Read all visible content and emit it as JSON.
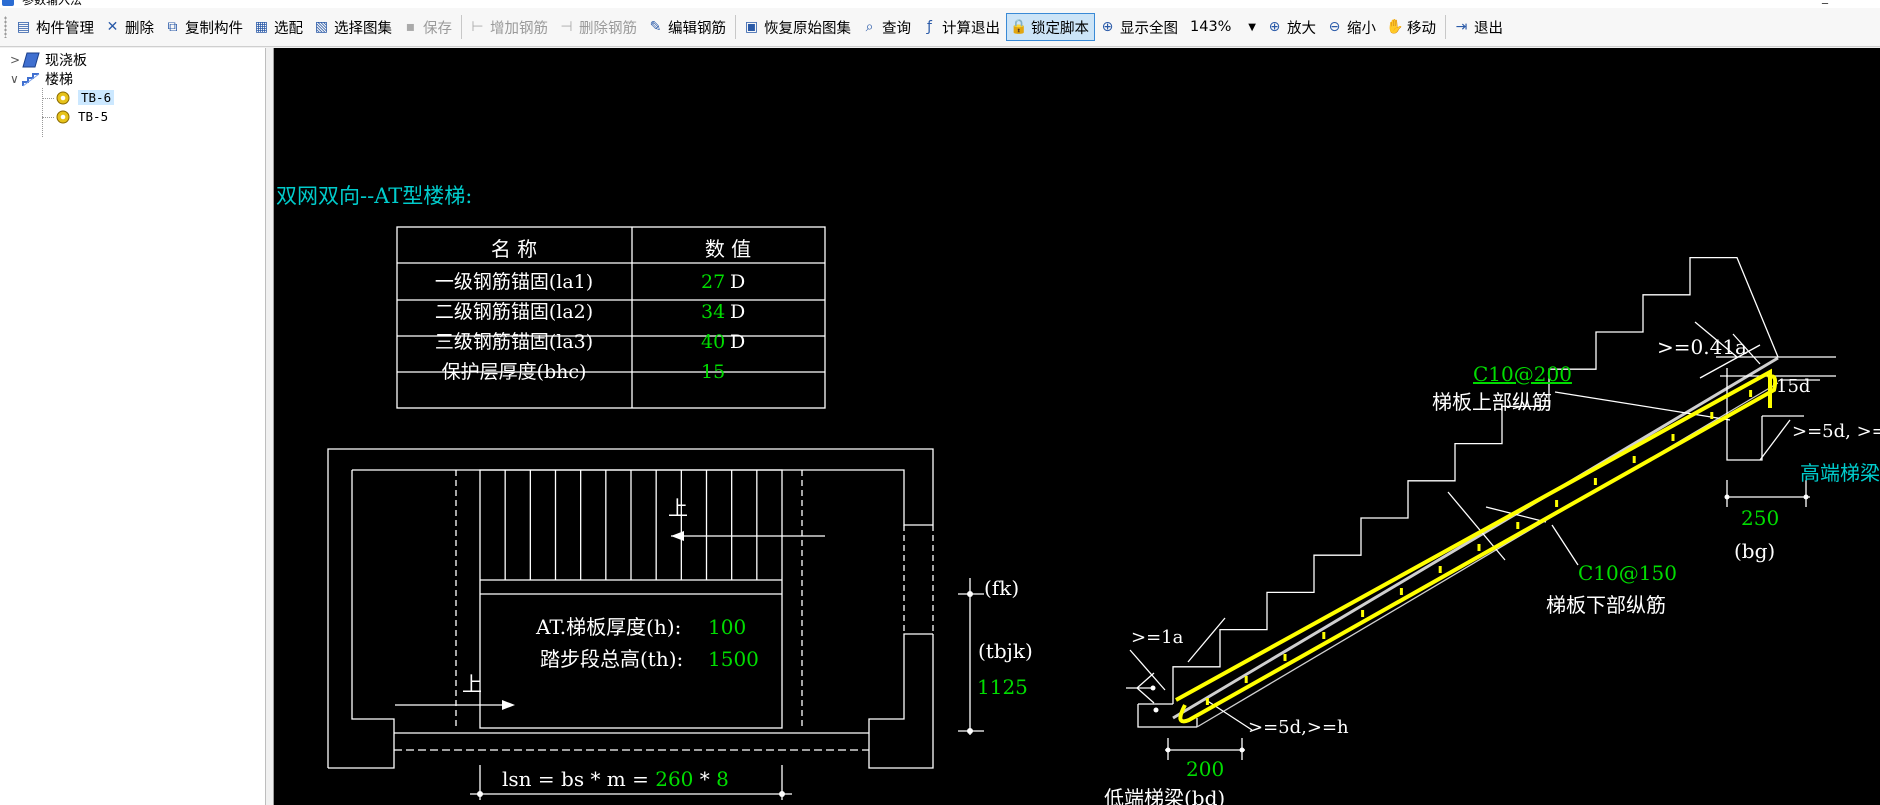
{
  "titlebar": {
    "title": "参数输入法",
    "minimize": "_"
  },
  "toolbar": {
    "items": [
      {
        "name": "component-manage",
        "icon": "▤",
        "label": "构件管理",
        "enabled": true
      },
      {
        "name": "delete",
        "icon": "✕",
        "label": "删除",
        "enabled": true
      },
      {
        "name": "copy-component",
        "icon": "⧉",
        "label": "复制构件",
        "enabled": true
      },
      {
        "name": "select-diagram",
        "icon": "▦",
        "label": "选配",
        "enabled": true
      },
      {
        "name": "choose-diagram-set",
        "icon": "▧",
        "label": "选择图集",
        "enabled": true
      },
      {
        "name": "save",
        "icon": "▪",
        "label": "保存",
        "enabled": false
      },
      {
        "sep": true
      },
      {
        "name": "add-rebar",
        "icon": "⊢",
        "label": "增加钢筋",
        "enabled": false
      },
      {
        "name": "delete-rebar",
        "icon": "⊣",
        "label": "删除钢筋",
        "enabled": false
      },
      {
        "name": "edit-rebar",
        "icon": "✎",
        "label": "编辑钢筋",
        "enabled": true
      },
      {
        "sep": true
      },
      {
        "name": "restore-diagram",
        "icon": "▣",
        "label": "恢复原始图集",
        "enabled": true
      },
      {
        "name": "query",
        "icon": "⌕",
        "label": "查询",
        "enabled": true
      },
      {
        "name": "calc-exit",
        "icon": "ƒ",
        "label": "计算退出",
        "enabled": true
      },
      {
        "name": "lock-script",
        "icon": "🔒",
        "label": "锁定脚本",
        "enabled": true,
        "active": true
      },
      {
        "name": "show-all",
        "icon": "⊕",
        "label": "显示全图",
        "enabled": true
      },
      {
        "zoom": true
      },
      {
        "name": "zoom-in",
        "icon": "⊕",
        "label": "放大",
        "enabled": true
      },
      {
        "name": "zoom-out",
        "icon": "⊖",
        "label": "缩小",
        "enabled": true
      },
      {
        "name": "move",
        "icon": "✋",
        "label": "移动",
        "enabled": true
      },
      {
        "sep": true
      },
      {
        "name": "exit",
        "icon": "⇥",
        "label": "退出",
        "enabled": true
      }
    ],
    "zoom_value": "143%"
  },
  "tree": {
    "root1": {
      "label": "现浇板",
      "twisty": ">"
    },
    "root2": {
      "label": "楼梯",
      "twisty": "∨"
    },
    "children": [
      {
        "label": "TB-6",
        "selected": true
      },
      {
        "label": "TB-5",
        "selected": false
      }
    ]
  },
  "drawing": {
    "heading": "双网双向--AT型楼梯:",
    "table": {
      "headers": [
        "名  称",
        "数  值"
      ],
      "rows": [
        {
          "name": "一级钢筋锚固(la1)",
          "value": "27",
          "unit": "D"
        },
        {
          "name": "二级钢筋锚固(la2)",
          "value": "34",
          "unit": "D"
        },
        {
          "name": "三级钢筋锚固(la3)",
          "value": "40",
          "unit": "D"
        },
        {
          "name": "保护层厚度(bhc)",
          "value": "15",
          "unit": ""
        }
      ]
    },
    "plan": {
      "up1": "上",
      "up2": "上",
      "thickness_label": "AT.梯板厚度(h):",
      "thickness_value": "100",
      "height_label": "踏步段总高(th):",
      "height_value": "1500",
      "fk": "(fk)",
      "tbjk": "(tbjk)",
      "tbjk_value": "1125",
      "lsn_label": "lsn = bs * m = ",
      "bs_value": "260",
      "times": " * ",
      "m_value": "8"
    },
    "section": {
      "top_anchor": ">=0.41a",
      "top_rebar_spec": "C10@200",
      "top_rebar_label": "梯板上部纵筋",
      "hook_15d": "15d",
      "right_5d": ">=5d, >=",
      "high_beam": "高端梯梁",
      "bg_value": "250",
      "bg_label": "(bg)",
      "bottom_rebar_spec": "C10@150",
      "bottom_rebar_label": "梯板下部纵筋",
      "la_label": ">=1a",
      "left_5d": ">=5d,>=h",
      "bd_value": "200",
      "low_beam": "低端梯梁(bd)"
    },
    "colors": {
      "text": "#ffffff",
      "value": "#00dd00",
      "heading": "#00cccc",
      "rebar": "#ffff00",
      "line": "#ffffff"
    }
  }
}
